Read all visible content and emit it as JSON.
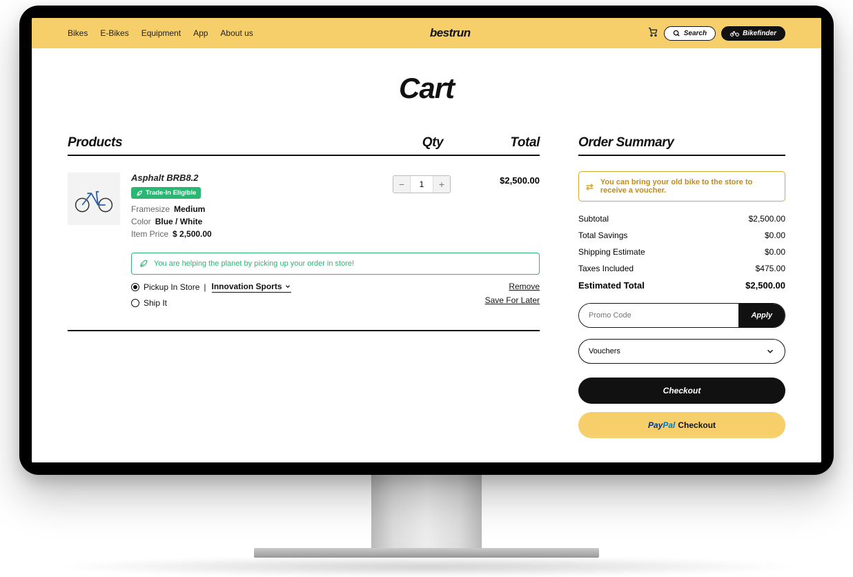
{
  "header": {
    "nav": [
      "Bikes",
      "E-Bikes",
      "Equipment",
      "App",
      "About us"
    ],
    "brand": "bestrun",
    "search_label": "Search",
    "finder_label": "Bikefinder"
  },
  "page": {
    "title": "Cart"
  },
  "left_head": {
    "products": "Products",
    "qty": "Qty",
    "total": "Total"
  },
  "item": {
    "name": "Asphalt BRB8.2",
    "badge": "Trade-In Eligible",
    "framesize_label": "Framesize",
    "framesize_value": "Medium",
    "color_label": "Color",
    "color_value": "Blue / White",
    "price_label": "Item Price",
    "price_value": "$ 2,500.00",
    "qty": "1",
    "line_total": "$2,500.00"
  },
  "eco_msg": "You are helping the planet by picking up your order in store!",
  "ship": {
    "pickup_label": "Pickup In Store",
    "store": "Innovation Sports",
    "ship_label": "Ship It",
    "remove": "Remove",
    "save": "Save For Later"
  },
  "summary": {
    "heading": "Order Summary",
    "notice": "You can bring your old bike to the store to receive a voucher.",
    "subtotal_label": "Subtotal",
    "subtotal": "$2,500.00",
    "savings_label": "Total Savings",
    "savings": "$0.00",
    "shipping_label": "Shipping Estimate",
    "shipping": "$0.00",
    "taxes_label": "Taxes Included",
    "taxes": "$475.00",
    "total_label": "Estimated Total",
    "total": "$2,500.00",
    "promo_placeholder": "Promo Code",
    "apply": "Apply",
    "vouchers_label": "Vouchers",
    "checkout": "Checkout",
    "paypal_brand_a": "Pay",
    "paypal_brand_b": "Pal",
    "paypal_suffix": "Checkout"
  }
}
